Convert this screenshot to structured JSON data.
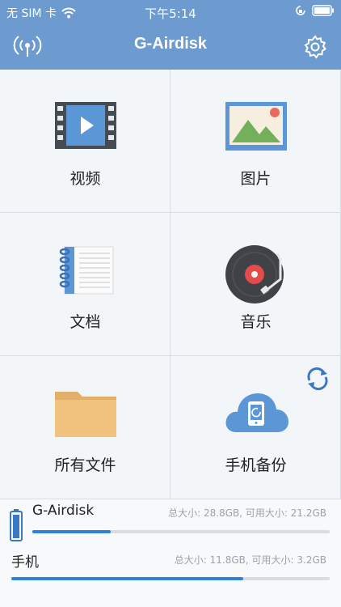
{
  "status": {
    "carrier": "无 SIM 卡",
    "time": "下午5:14"
  },
  "nav": {
    "title": "G-Airdisk"
  },
  "tiles": [
    {
      "label": "视频",
      "icon": "video-icon"
    },
    {
      "label": "图片",
      "icon": "picture-icon"
    },
    {
      "label": "文档",
      "icon": "document-icon"
    },
    {
      "label": "音乐",
      "icon": "music-icon"
    },
    {
      "label": "所有文件",
      "icon": "folder-icon"
    },
    {
      "label": "手机备份",
      "icon": "cloud-backup-icon"
    }
  ],
  "storage": {
    "device": {
      "name": "G-Airdisk",
      "info": "总大小: 28.8GB, 可用大小: 21.2GB",
      "used_fraction": 0.264
    },
    "phone": {
      "name": "手机",
      "info": "总大小: 11.8GB, 可用大小: 3.2GB",
      "used_fraction": 0.729
    }
  },
  "colors": {
    "accent": "#6d9bcf",
    "progress": "#2e82dc"
  }
}
